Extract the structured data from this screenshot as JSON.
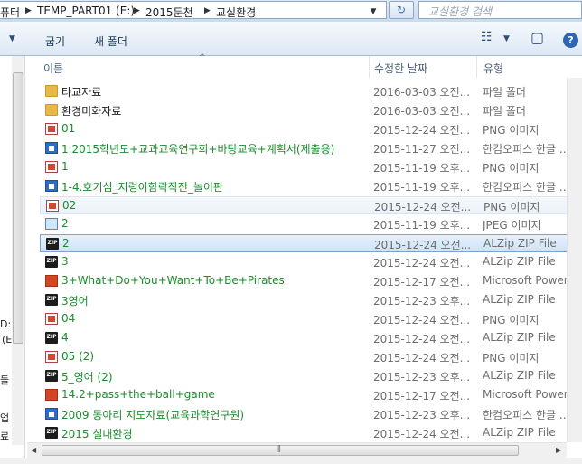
{
  "address": {
    "crumbs": [
      "퓨터",
      "TEMP_PART01 (E:)",
      "2015둔천",
      "교실환경"
    ],
    "separator": "▶",
    "dropdown": "▼",
    "refresh": "↻"
  },
  "search": {
    "placeholder": "교실환경 검색"
  },
  "toolbar": {
    "left_arrow": "▼",
    "share_label": "굽기",
    "new_folder_label": "새 폴더",
    "view_icon": "☷",
    "view_dropdown": "▼",
    "preview_icon": "▢",
    "help": "?"
  },
  "nav": {
    "fragments": [
      "D:)",
      "(E",
      "들",
      "업",
      "료"
    ]
  },
  "columns": {
    "name": "이름",
    "date": "수정한 날짜",
    "type": "유형",
    "sort_indicator": "^"
  },
  "files": [
    {
      "icon": "folder",
      "name": "타교자료",
      "date": "2016-03-03 오전...",
      "type": "파일 폴더",
      "green": false
    },
    {
      "icon": "folder",
      "name": "환경미화자료",
      "date": "2016-03-03 오전...",
      "type": "파일 폴더",
      "green": false
    },
    {
      "icon": "png",
      "name": "01",
      "date": "2015-12-24 오전...",
      "type": "PNG 이미지",
      "green": true
    },
    {
      "icon": "hwp",
      "name": "1.2015학년도+교과교육연구회+바탕교육+계획서(제출용)",
      "date": "2015-11-27 오전...",
      "type": "한컴오피스 한글 ...",
      "green": true
    },
    {
      "icon": "png",
      "name": "1",
      "date": "2015-11-19 오후...",
      "type": "PNG 이미지",
      "green": true
    },
    {
      "icon": "hwp",
      "name": "1-4.호기심_지렁이함락작전_놀이판",
      "date": "2015-11-19 오후...",
      "type": "한컴오피스 한글 ...",
      "green": true
    },
    {
      "icon": "png",
      "name": "02",
      "date": "2015-12-24 오전...",
      "type": "PNG 이미지",
      "green": true
    },
    {
      "icon": "jpeg",
      "name": "2",
      "date": "2015-11-19 오후...",
      "type": "JPEG 이미지",
      "green": true
    },
    {
      "icon": "zip",
      "name": "2",
      "date": "2015-12-24 오전...",
      "type": "ALZip ZIP File",
      "green": true
    },
    {
      "icon": "zip",
      "name": "3",
      "date": "2015-12-24 오전...",
      "type": "ALZip ZIP File",
      "green": true
    },
    {
      "icon": "ppt",
      "name": "3+What+Do+You+Want+To+Be+Pirates",
      "date": "2015-12-17 오전...",
      "type": "Microsoft PowerP...",
      "green": true
    },
    {
      "icon": "zip",
      "name": "3영어",
      "date": "2015-12-23 오후...",
      "type": "ALZip ZIP File",
      "green": true
    },
    {
      "icon": "png",
      "name": "04",
      "date": "2015-12-24 오전...",
      "type": "PNG 이미지",
      "green": true
    },
    {
      "icon": "zip",
      "name": "4",
      "date": "2015-12-24 오전...",
      "type": "ALZip ZIP File",
      "green": true
    },
    {
      "icon": "png",
      "name": "05 (2)",
      "date": "2015-12-24 오전...",
      "type": "PNG 이미지",
      "green": true
    },
    {
      "icon": "zip",
      "name": "5_영어 (2)",
      "date": "2015-12-23 오후...",
      "type": "ALZip ZIP File",
      "green": true
    },
    {
      "icon": "ppt",
      "name": "14.2+pass+the+ball+game",
      "date": "2015-12-17 오전...",
      "type": "Microsoft PowerP...",
      "green": true
    },
    {
      "icon": "hwp",
      "name": "2009 동아리 지도자료(교육과학연구원)",
      "date": "2015-12-23 오후...",
      "type": "한컴오피스 한글 ...",
      "green": true
    },
    {
      "icon": "zip",
      "name": "2015 실내환경",
      "date": "2015-12-24 오전...",
      "type": "ALZip ZIP File",
      "green": true
    }
  ],
  "selection": {
    "selected_index": 8,
    "hover_index": 6
  },
  "scroll": {
    "left_arrow": "◀",
    "right_arrow": "▶",
    "grip": "|||"
  },
  "icon_labels": {
    "zip": "ZIP"
  }
}
